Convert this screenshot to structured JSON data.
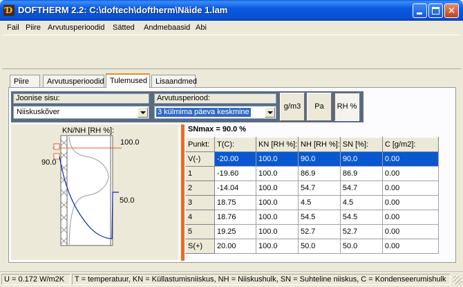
{
  "window": {
    "title": "DOFTHERM 2.2: C:\\doftech\\doftherm\\Näide 1.lam",
    "icon": "doftherm-app-icon"
  },
  "menu": [
    "Fail",
    "Piire",
    "Arvutusperioodid",
    "Sätted",
    "Andmebaasid",
    "Abi"
  ],
  "tabs": [
    {
      "label": "Piire",
      "active": false
    },
    {
      "label": "Arvutusperioodid",
      "active": false
    },
    {
      "label": "Tulemused",
      "active": true
    },
    {
      "label": "Lisaandmed",
      "active": false
    }
  ],
  "controls": {
    "content_label": "Joonise sisu:",
    "content_value": "Niiskuskõver",
    "period_label": "Arvutusperiood:",
    "period_value": "3 külmima päeva keskmine",
    "unit_buttons": [
      {
        "label": "g/m3",
        "pressed": false
      },
      {
        "label": "Pa",
        "pressed": false
      },
      {
        "label": "RH %",
        "pressed": true
      }
    ]
  },
  "chart": {
    "title": "KN/NH [RH %]:",
    "label_top": "100.0",
    "label_left": "90.0",
    "label_right": "50.0",
    "colors": {
      "curve": "#0a28b4",
      "limit": "#e06020"
    }
  },
  "grid": {
    "title": "SNmax = 90.0 %",
    "columns": [
      "Punkt:",
      "T(C):",
      "KN [RH %]:",
      "NH [RH %]:",
      "SN [%]:",
      "C [g/m2]:"
    ],
    "rows": [
      [
        "V(-)",
        "-20.00",
        "100.0",
        "90.0",
        "90.0",
        "0.00"
      ],
      [
        "1",
        "-19.60",
        "100.0",
        "86.9",
        "86.9",
        "0.00"
      ],
      [
        "2",
        "-14.04",
        "100.0",
        "54.7",
        "54.7",
        "0.00"
      ],
      [
        "3",
        "18.75",
        "100.0",
        "4.5",
        "4.5",
        "0.00"
      ],
      [
        "4",
        "18.76",
        "100.0",
        "54.5",
        "54.5",
        "0.00"
      ],
      [
        "5",
        "19.25",
        "100.0",
        "52.7",
        "52.7",
        "0.00"
      ],
      [
        "S(+)",
        "20.00",
        "100.0",
        "50.0",
        "50.0",
        "0.00"
      ]
    ],
    "selected_row": 0
  },
  "status": {
    "u_value": "U = 0.172 W/m2K",
    "legend": "T = temperatuur, KN = Küllastumisniiskus, NH = Niiskushulk, SN = Suhteline niiskus, C = Kondenseerumishulk"
  }
}
